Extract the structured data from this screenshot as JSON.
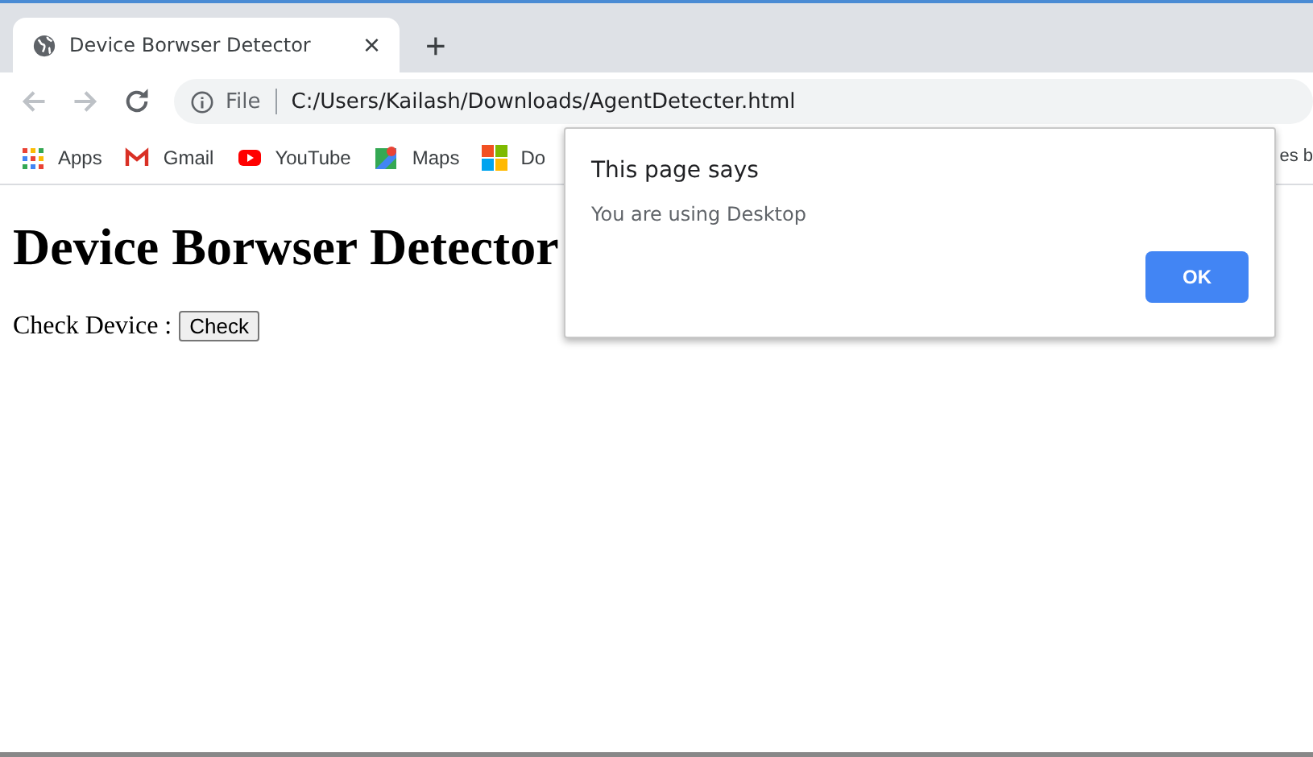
{
  "tab": {
    "title": "Device Borwser Detector",
    "close": "×",
    "new_tab": "+"
  },
  "address_bar": {
    "scheme": "File",
    "url": "C:/Users/Kailash/Downloads/AgentDetecter.html"
  },
  "bookmarks": [
    {
      "kind": "apps",
      "label": "Apps"
    },
    {
      "kind": "gmail",
      "label": "Gmail"
    },
    {
      "kind": "youtube",
      "label": "YouTube"
    },
    {
      "kind": "maps",
      "label": "Maps"
    },
    {
      "kind": "windows",
      "label": "Do"
    }
  ],
  "bookmarks_overflow": "es b",
  "page": {
    "heading": "Device Borwser Detector",
    "label": "Check Device :",
    "button": "Check"
  },
  "dialog": {
    "title": "This page says",
    "message": "You are using Desktop",
    "button": "OK"
  }
}
